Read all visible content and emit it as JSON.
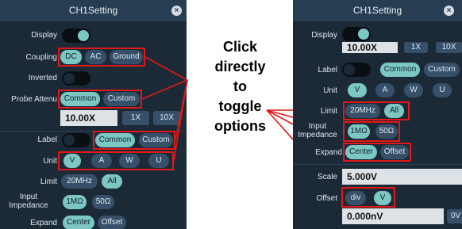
{
  "left_panel": {
    "title": "CH1Setting",
    "close": "×",
    "display_label": "Display",
    "coupling_label": "Coupling",
    "coupling_options": [
      "DC",
      "AC",
      "Ground"
    ],
    "inverted_label": "Inverted",
    "probe_label": "Probe Attenu",
    "probe_options": [
      "Common",
      "Custom"
    ],
    "probe_value": "10.00X",
    "probe_buttons": [
      "1X",
      "10X"
    ],
    "label_label": "Label",
    "label_options": [
      "Common",
      "Custom"
    ],
    "unit_label": "Unit",
    "unit_options": [
      "V",
      "A",
      "W",
      "U"
    ],
    "limit_label": "Limit",
    "limit_options": [
      "20MHz",
      "All"
    ],
    "impedance_label": "Input\nImpedance",
    "impedance_options": [
      "1MΩ",
      "50Ω"
    ],
    "expand_label": "Expand",
    "expand_options": [
      "Center",
      "Offset"
    ]
  },
  "right_panel": {
    "title": "CH1Setting",
    "close": "×",
    "display_label": "Display",
    "probe_value": "10.00X",
    "probe_buttons": [
      "1X",
      "10X"
    ],
    "label_label": "Label",
    "label_options": [
      "Common",
      "Custom"
    ],
    "unit_label": "Unit",
    "unit_options": [
      "V",
      "A",
      "W",
      "U"
    ],
    "limit_label": "Limit",
    "limit_options": [
      "20MHz",
      "All"
    ],
    "impedance_label": "Input\nImpedance",
    "impedance_options": [
      "1MΩ",
      "50Ω"
    ],
    "expand_label": "Expand",
    "expand_options": [
      "Center",
      "Offset"
    ],
    "scale_label": "Scale",
    "scale_value": "5.000V",
    "offset_label": "Offset",
    "offset_options": [
      "div",
      "V"
    ],
    "offset_value": "0.000nV",
    "offset_button": "0V"
  },
  "callout": {
    "lines": [
      "Click",
      "directly",
      "to",
      "toggle",
      "options"
    ]
  },
  "colors": {
    "panel_bg": "#1c2a38",
    "selected": "#7cc7c4",
    "highlight": "#e01818"
  }
}
